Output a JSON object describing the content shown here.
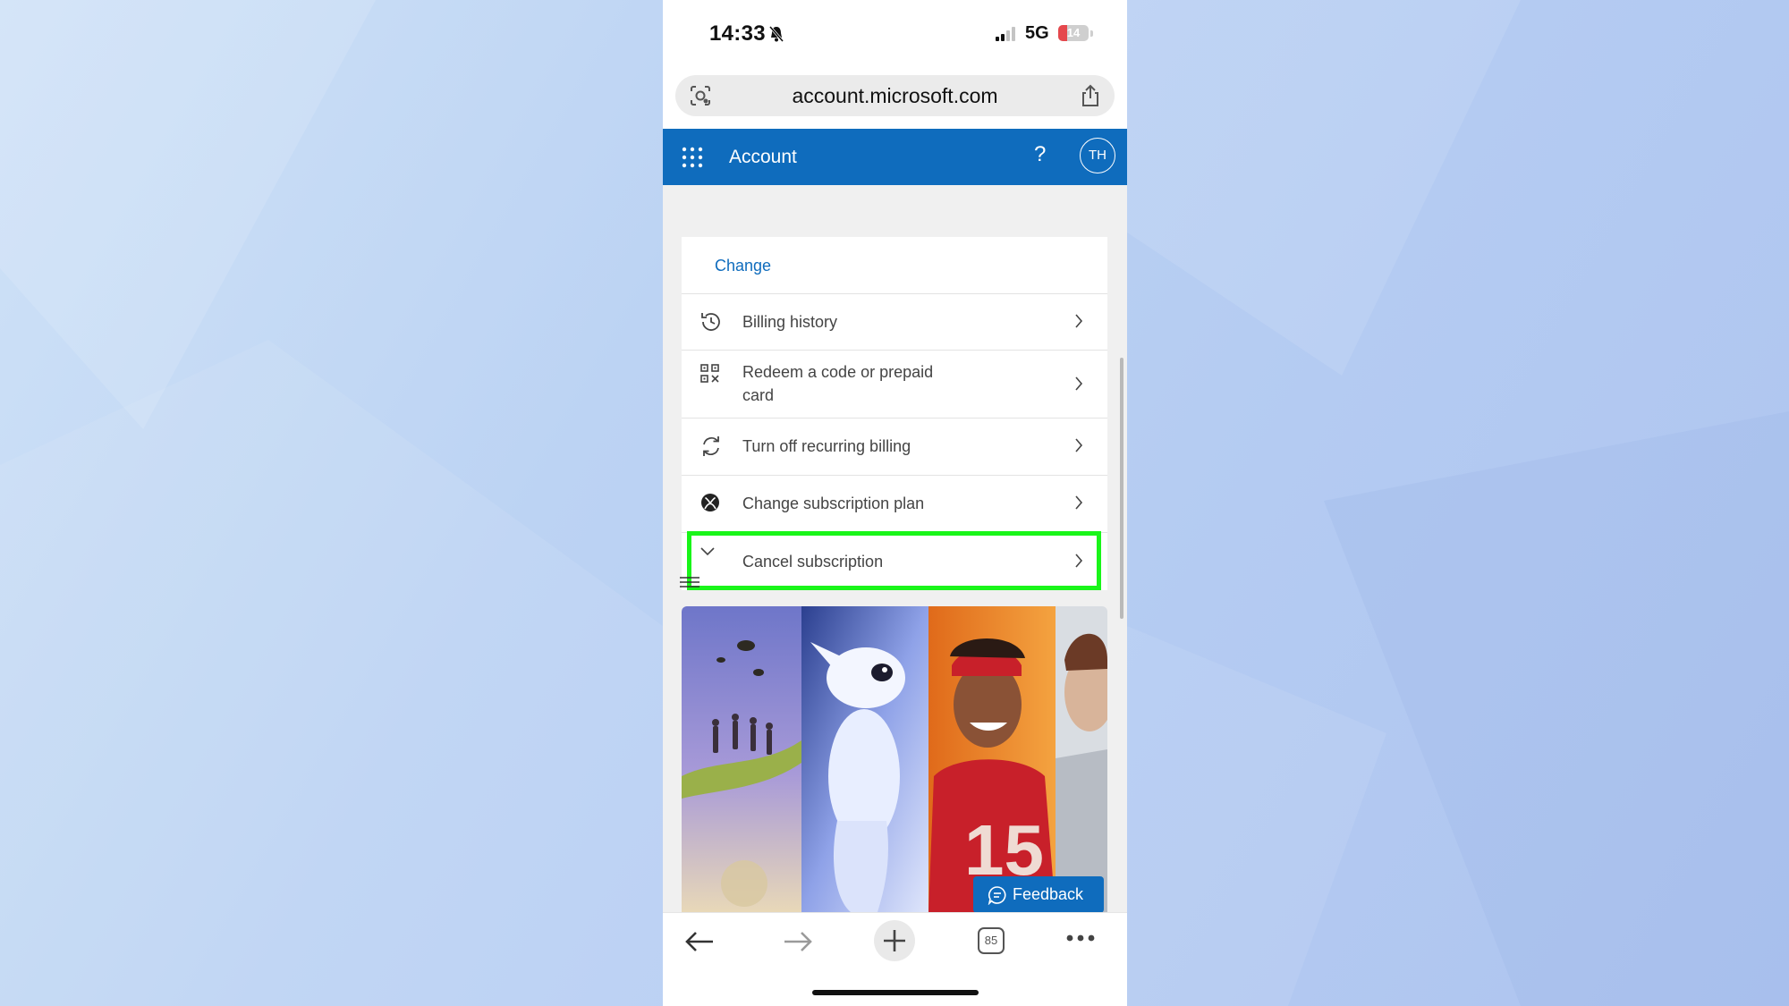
{
  "status_bar": {
    "time": "14:33",
    "network": "5G",
    "battery": "14"
  },
  "browser": {
    "url": "account.microsoft.com",
    "tab_count": "85"
  },
  "header": {
    "title": "Account",
    "help": "?",
    "avatar_initials": "TH"
  },
  "card": {
    "change_link": "Change",
    "items": [
      {
        "label": "Billing history",
        "icon": "history-icon"
      },
      {
        "label": "Redeem a code or prepaid card",
        "icon": "qr-code-icon"
      },
      {
        "label": "Turn off recurring billing",
        "icon": "refresh-icon"
      },
      {
        "label": "Change subscription plan",
        "icon": "xbox-icon"
      },
      {
        "label": "Cancel subscription",
        "icon": "chevron-down-icon"
      }
    ]
  },
  "feedback": {
    "label": "Feedback"
  },
  "colors": {
    "brand": "#0f6cbd",
    "highlight": "#19f519",
    "page_bg": "#f0f0f0"
  }
}
